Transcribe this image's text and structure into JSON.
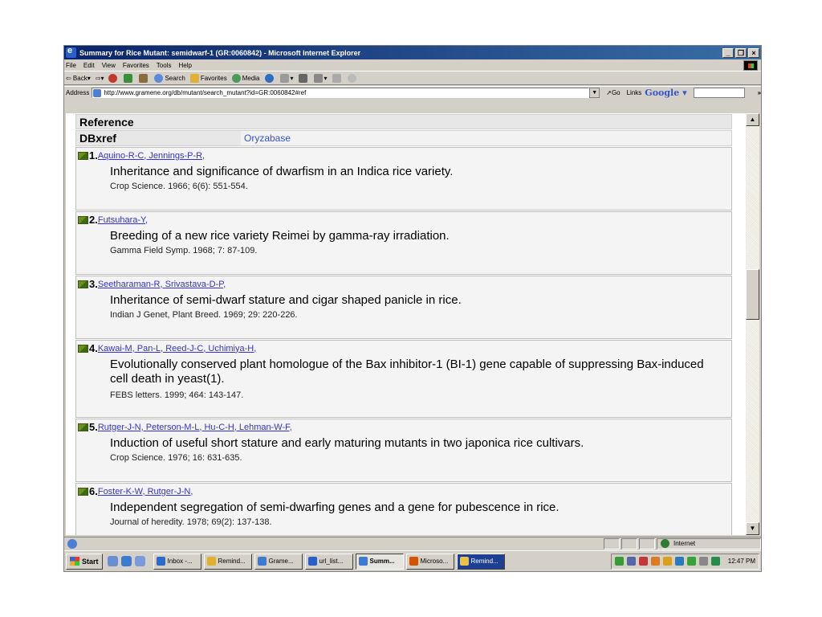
{
  "window": {
    "title": "Summary for Rice Mutant: semidwarf-1 (GR:0060842) - Microsoft Internet Explorer",
    "minimize": "_",
    "restore": "❐",
    "close": "×"
  },
  "menu": [
    "File",
    "Edit",
    "View",
    "Favorites",
    "Tools",
    "Help"
  ],
  "toolbar": {
    "back": "⇦ Back",
    "forward": "⇨",
    "search": "Search",
    "favorites": "Favorites",
    "media": "Media"
  },
  "address": {
    "label": "Address",
    "url": "http://www.gramene.org/db/mutant/search_mutant?id=GR:0060842#ref",
    "go": "Go",
    "links": "Links",
    "google": "Google",
    "more": "»"
  },
  "reference": {
    "header": "Reference",
    "dbxref_label": "DBxref",
    "dbxref_value": "Oryzabase",
    "entries": [
      {
        "num": "1.",
        "authors": "Aquino-R-C, Jennings-P-R,",
        "title": "Inheritance and significance of dwarfism in an Indica rice variety.",
        "citation": "Crop Science. 1966; 6(6): 551-554."
      },
      {
        "num": "2.",
        "authors": "Futsuhara-Y,",
        "title": "Breeding of a new rice variety Reimei by gamma-ray irradiation.",
        "citation": "Gamma Field Symp. 1968; 7: 87-109."
      },
      {
        "num": "3.",
        "authors": "Seetharaman-R, Srivastava-D-P,",
        "title": "Inheritance of semi-dwarf stature and cigar shaped panicle in rice.",
        "citation": "Indian J Genet, Plant Breed. 1969; 29: 220-226."
      },
      {
        "num": "4.",
        "authors": "Kawai-M, Pan-L, Reed-J-C, Uchimiya-H,",
        "title": "Evolutionally conserved plant homologue of the Bax inhibitor-1 (BI-1) gene capable of suppressing Bax-induced cell death in yeast(1).",
        "citation": "FEBS letters. 1999; 464: 143-147."
      },
      {
        "num": "5.",
        "authors": "Rutger-J-N, Peterson-M-L, Hu-C-H, Lehman-W-F,",
        "title": "Induction of useful short stature and early maturing mutants in two japonica rice cultivars.",
        "citation": "Crop Science. 1976; 16: 631-635."
      },
      {
        "num": "6.",
        "authors": "Foster-K-W, Rutger-J-N,",
        "title": "Independent segregation of semi-dwarfing genes and a gene for pubescence in rice.",
        "citation": "Journal of heredity. 1978; 69(2): 137-138."
      }
    ]
  },
  "status": {
    "zone": "Internet"
  },
  "taskbar": {
    "start": "Start",
    "tasks": [
      "Inbox -...",
      "Remind...",
      "Grame...",
      "url_list...",
      "Summ...",
      "Microso...",
      "Remind..."
    ],
    "clock": "12:47 PM"
  },
  "colors": {
    "titlebar": "#0a246a",
    "link": "#3333cc",
    "chrome": "#d4d0c8"
  }
}
